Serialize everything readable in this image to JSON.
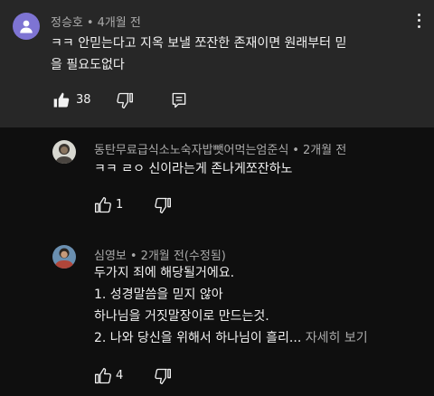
{
  "comment1": {
    "author": "정승호",
    "time": "4개월 전",
    "text_line1": "ㅋㅋ 안믿는다고 지옥 보낼 쪼잔한 존재이면 원래부터 믿",
    "text_line2": "을 필요도없다",
    "like_count": "38",
    "avatar_color": "#7e74d3",
    "icons": [
      "person-icon",
      "kebab-menu-icon",
      "thumbs-up-filled-icon",
      "thumbs-down-icon",
      "reply-icon"
    ]
  },
  "comment2": {
    "author": "동탄무료급식소노숙자밥뺏어먹는엄준식",
    "time": "2개월 전",
    "text": "ㅋㅋ ㄹㅇ 신이라는게 존나게쪼잔하노",
    "like_count": "1",
    "icons": [
      "avatar-photo",
      "thumbs-up-icon",
      "thumbs-down-icon"
    ]
  },
  "comment3": {
    "author": "심영보",
    "time": "2개월 전(수정됨)",
    "lines": [
      "두가지 죄에 해당될거에요.",
      "1. 성경말씀을 믿지 않아",
      "하나님을 거짓말장이로 만드는것.",
      "2. 나와 당신을 위해서 하나님이 흘리..."
    ],
    "more_label": "자세히 보기",
    "like_count": "4",
    "icons": [
      "avatar-photo",
      "thumbs-up-icon",
      "thumbs-down-icon"
    ]
  },
  "separator": "•"
}
